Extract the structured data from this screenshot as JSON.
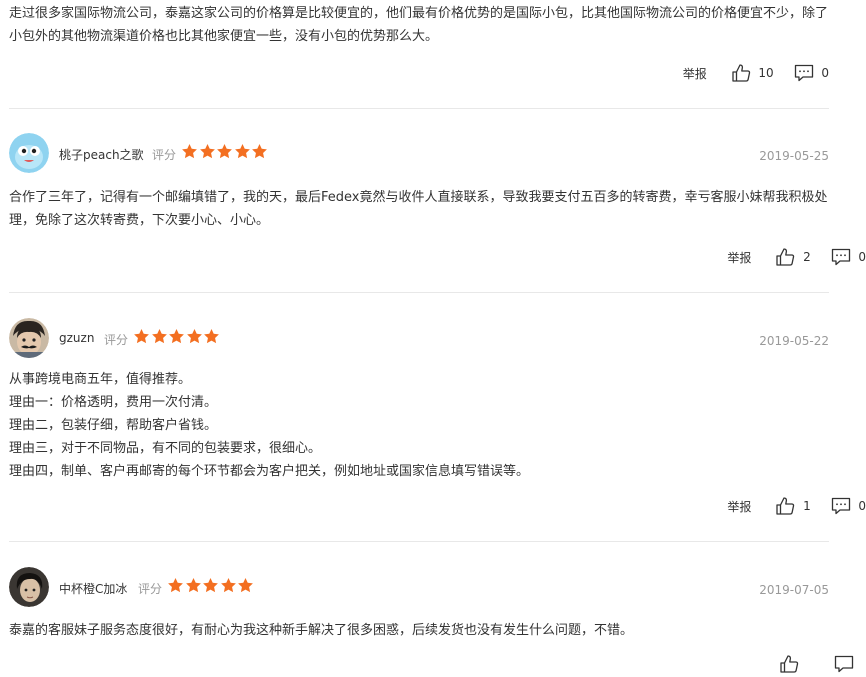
{
  "reviews": [
    {
      "text": "走过很多家国际物流公司，泰嘉这家公司的价格算是比较便宜的，他们最有价格优势的是国际小包，比其他国际物流公司的价格便宜不少，除了小包外的其他物流渠道价格也比其他家便宜一些，没有小包的优势那么大。",
      "report_label": "举报",
      "likes": "10",
      "comments": "0"
    },
    {
      "username": "桃子peach之歌",
      "rating_label": "评分",
      "stars": 5,
      "date": "2019-05-25",
      "text": "合作了三年了，记得有一个邮编填错了，我的天，最后Fedex竟然与收件人直接联系，导致我要支付五百多的转寄费，幸亏客服小妹帮我积极处理，免除了这次转寄费，下次要小心、小心。",
      "report_label": "举报",
      "likes": "2",
      "comments": "0"
    },
    {
      "username": "gzuzn",
      "rating_label": "评分",
      "stars": 5,
      "date": "2019-05-22",
      "lines": [
        "从事跨境电商五年，值得推荐。",
        "理由一：价格透明，费用一次付清。",
        "理由二，包装仔细，帮助客户省钱。",
        "理由三，对于不同物品，有不同的包装要求，很细心。",
        "理由四，制单、客户再邮寄的每个环节都会为客户把关，例如地址或国家信息填写错误等。"
      ],
      "report_label": "举报",
      "likes": "1",
      "comments": "0"
    },
    {
      "username": "中杯橙C加冰",
      "rating_label": "评分",
      "stars": 5,
      "date": "2019-07-05",
      "text": "泰嘉的客服妹子服务态度很好，有耐心为我这种新手解决了很多困惑，后续发货也没有发生什么问题，不错。"
    }
  ],
  "colors": {
    "star": "#f36f21",
    "muted": "#999999",
    "divider": "#e8e8e8"
  },
  "icons": {
    "like": "thumbs-up-icon",
    "comment": "comment-bubble-icon",
    "star": "star-icon"
  }
}
